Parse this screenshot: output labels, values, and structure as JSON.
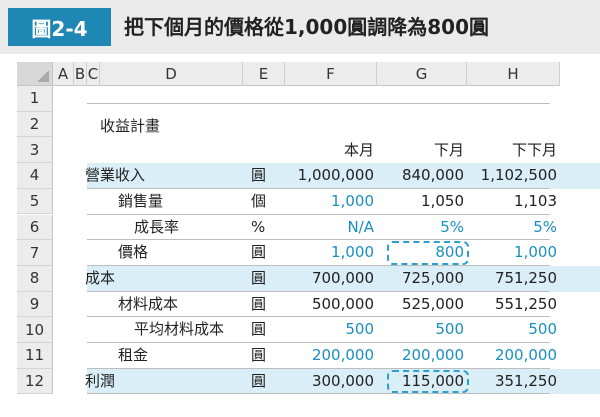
{
  "caption": {
    "badge": "圖2-4",
    "title": "把下個月的價格從1,000圓調降為800圓"
  },
  "columns": [
    "A",
    "B",
    "C",
    "D",
    "E",
    "F",
    "G",
    "H"
  ],
  "row_numbers": [
    "1",
    "2",
    "3",
    "4",
    "5",
    "6",
    "7",
    "8",
    "9",
    "10",
    "11",
    "12"
  ],
  "sheet": {
    "plan_title": "收益計畫",
    "period_headers": [
      "本月",
      "下月",
      "下下月"
    ],
    "rows": [
      {
        "label": "營業收入",
        "unit": "圓",
        "values": [
          "1,000,000",
          "840,000",
          "1,102,500"
        ],
        "highlight": true,
        "indent": 0,
        "blue": [
          false,
          false,
          false
        ]
      },
      {
        "label": "銷售量",
        "unit": "個",
        "values": [
          "1,000",
          "1,050",
          "1,103"
        ],
        "highlight": false,
        "indent": 1,
        "blue": [
          true,
          false,
          false
        ]
      },
      {
        "label": "成長率",
        "unit": "%",
        "values": [
          "N/A",
          "5%",
          "5%"
        ],
        "highlight": false,
        "indent": 2,
        "blue": [
          true,
          true,
          true
        ]
      },
      {
        "label": "價格",
        "unit": "圓",
        "values": [
          "1,000",
          "800",
          "1,000"
        ],
        "highlight": false,
        "indent": 1,
        "blue": [
          true,
          true,
          true
        ]
      },
      {
        "label": "成本",
        "unit": "圓",
        "values": [
          "700,000",
          "725,000",
          "751,250"
        ],
        "highlight": true,
        "indent": 0,
        "blue": [
          false,
          false,
          false
        ]
      },
      {
        "label": "材料成本",
        "unit": "圓",
        "values": [
          "500,000",
          "525,000",
          "551,250"
        ],
        "highlight": false,
        "indent": 1,
        "blue": [
          false,
          false,
          false
        ]
      },
      {
        "label": "平均材料成本",
        "unit": "圓",
        "values": [
          "500",
          "500",
          "500"
        ],
        "highlight": false,
        "indent": 2,
        "blue": [
          true,
          true,
          true
        ]
      },
      {
        "label": "租金",
        "unit": "圓",
        "values": [
          "200,000",
          "200,000",
          "200,000"
        ],
        "highlight": false,
        "indent": 1,
        "blue": [
          true,
          true,
          true
        ]
      },
      {
        "label": "利潤",
        "unit": "圓",
        "values": [
          "300,000",
          "115,000",
          "351,250"
        ],
        "highlight": true,
        "indent": 0,
        "blue": [
          false,
          false,
          false
        ]
      }
    ]
  }
}
